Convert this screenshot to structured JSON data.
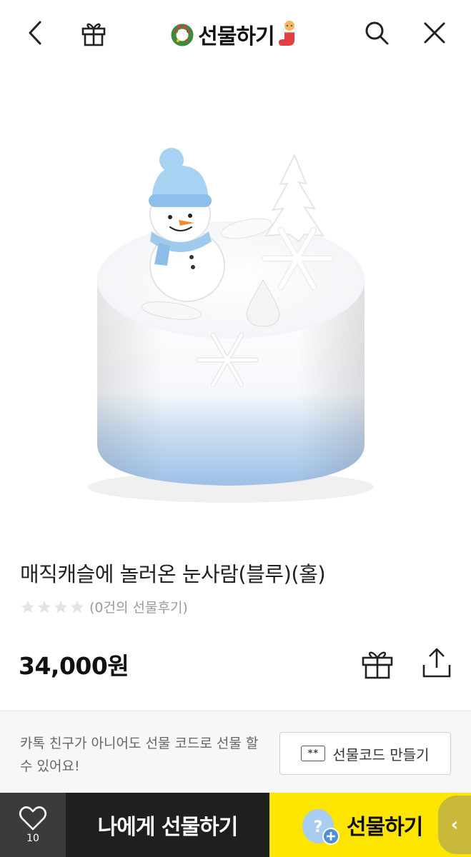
{
  "header": {
    "title": "선물하기",
    "icons": {
      "back": "chevron-left-icon",
      "gift": "gift-icon",
      "search": "search-icon",
      "close": "close-icon"
    }
  },
  "product": {
    "name": "매직캐슬에 놀러온 눈사람(블루)(홀)",
    "rating_stars": 0,
    "review_text": "(0건의 선물후기)",
    "price": "34,000원"
  },
  "gift_code": {
    "description": "카톡 친구가 아니어도 선물 코드로 선물 할 수 있어요!",
    "button_label": "선물코드 만들기",
    "icon_text": "**"
  },
  "bottom_bar": {
    "wish_count": "10",
    "gift_self_label": "나에게 선물하기",
    "gift_label": "선물하기",
    "side_tab_glyph": "‹"
  },
  "colors": {
    "brand_yellow": "#fee500",
    "dark_button": "#1f1f1f",
    "wish_bg": "#3b3b3b",
    "cake_blue": "#a9c8ea"
  }
}
